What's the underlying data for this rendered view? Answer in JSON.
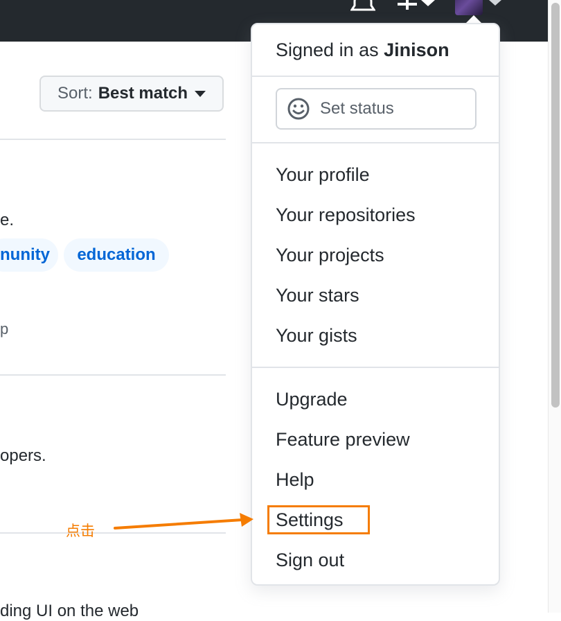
{
  "header": {
    "icons": [
      "bell-icon",
      "plus-icon",
      "caret-down-icon",
      "avatar",
      "caret-down-icon"
    ]
  },
  "search_results": {
    "sort": {
      "label": "Sort:",
      "value": "Best match"
    },
    "fragments": {
      "line1": "e.",
      "topic_1": "nunity",
      "topic_2": "education",
      "line2": "p",
      "line3": "opers.",
      "line4": "ding UI on the web"
    }
  },
  "user_menu": {
    "signed_in_prefix": "Signed in as",
    "username": "Jinison",
    "set_status": "Set status",
    "section1": [
      "Your profile",
      "Your repositories",
      "Your projects",
      "Your stars",
      "Your gists"
    ],
    "section2": [
      "Upgrade",
      "Feature preview",
      "Help",
      "Settings",
      "Sign out"
    ]
  },
  "annotation": {
    "text": "点击",
    "color": "#f57c00",
    "target": "Settings"
  },
  "colors": {
    "header_bg": "#24292e",
    "link": "#0366d6",
    "topic_bg": "#f1f8ff",
    "annotation": "#f57c00"
  }
}
